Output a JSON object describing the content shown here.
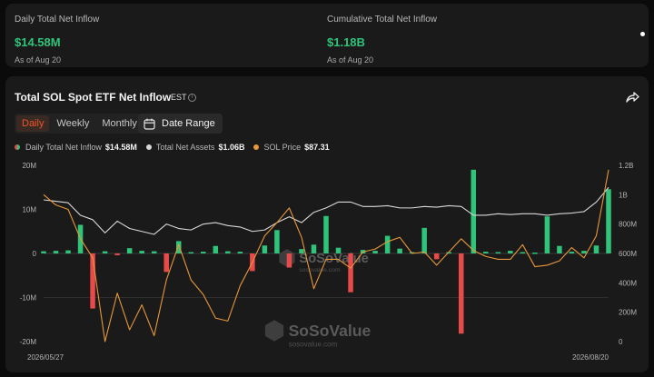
{
  "stats": [
    {
      "label": "Daily Total Net Inflow",
      "value": "$14.58M",
      "as_of": "As of Aug 20"
    },
    {
      "label": "Cumulative Total Net Inflow",
      "value": "$1.18B",
      "as_of": "As of Aug 20"
    }
  ],
  "chart_card": {
    "title": "Total SOL Spot ETF Net Inflow",
    "timezone": "EST",
    "info_glyph": "i",
    "tabs": [
      "Daily",
      "Weekly",
      "Monthly"
    ],
    "active_tab": "Daily",
    "date_range_label": "Date Range",
    "legend": [
      {
        "name": "Daily Total Net Inflow",
        "value": "$14.58M",
        "color_pos": "#2fc47a",
        "color_neg": "#e84a4a"
      },
      {
        "name": "Total Net Assets",
        "value": "$1.06B",
        "color": "#d8d8d8"
      },
      {
        "name": "SOL Price",
        "value": "$87.31",
        "color": "#e8973a"
      }
    ],
    "watermark": {
      "brand": "SoSoValue",
      "site": "sosovalue.com"
    },
    "icons": [
      "info-icon",
      "share-icon",
      "calendar-icon"
    ]
  },
  "chart_data": {
    "type": "bar",
    "x_start_label": "2026/05/27",
    "x_end_label": "2026/08/20",
    "left_axis": {
      "ticks": [
        "20M",
        "10M",
        "0",
        "-10M",
        "-20M"
      ],
      "values": [
        20,
        10,
        0,
        -10,
        -20
      ],
      "range": [
        -20,
        20
      ]
    },
    "right_axis": {
      "ticks": [
        "1.2B",
        "1B",
        "800M",
        "600M",
        "400M",
        "200M",
        "0"
      ],
      "values": [
        1.2,
        1.0,
        0.8,
        0.6,
        0.4,
        0.2,
        0
      ],
      "range": [
        0,
        1.2
      ]
    },
    "series": [
      {
        "name": "Daily Total Net Inflow",
        "type": "bar",
        "color_positive": "#2fc47a",
        "color_negative": "#e84a4a",
        "values": [
          0.5,
          0.6,
          0.7,
          6.5,
          -12.5,
          0.5,
          -0.4,
          1.2,
          0.6,
          0.5,
          -4.2,
          2.8,
          0.3,
          0.4,
          1.7,
          0.5,
          0.4,
          -4.0,
          1.8,
          5.3,
          -3.2,
          1.0,
          2.0,
          8.5,
          1.3,
          -8.8,
          0.8,
          0.6,
          4.0,
          1.1,
          0.3,
          5.8,
          -1.3,
          0.3,
          -18.2,
          19.0,
          0.4,
          0.3,
          0.6,
          0.3,
          0.2,
          8.4,
          1.7,
          0.4,
          0.6,
          1.8,
          14.58
        ]
      },
      {
        "name": "Total Net Assets",
        "type": "line",
        "axis": "right",
        "color": "#d8d8d8",
        "values": [
          0.965,
          0.955,
          0.945,
          0.86,
          0.83,
          0.74,
          0.82,
          0.77,
          0.75,
          0.73,
          0.8,
          0.77,
          0.76,
          0.8,
          0.81,
          0.79,
          0.78,
          0.75,
          0.76,
          0.81,
          0.85,
          0.81,
          0.88,
          0.91,
          0.95,
          0.95,
          0.92,
          0.92,
          0.925,
          0.91,
          0.91,
          0.92,
          0.915,
          0.925,
          0.92,
          0.86,
          0.86,
          0.87,
          0.865,
          0.87,
          0.87,
          0.86,
          0.87,
          0.875,
          0.885,
          0.95,
          1.05
        ]
      },
      {
        "name": "SOL Price",
        "type": "line",
        "axis": "right",
        "color": "#e8973a",
        "values": [
          1.0,
          0.93,
          0.9,
          0.7,
          0.57,
          0.0,
          0.33,
          0.08,
          0.25,
          0.04,
          0.42,
          0.66,
          0.42,
          0.32,
          0.16,
          0.14,
          0.38,
          0.54,
          0.72,
          0.81,
          0.91,
          0.71,
          0.36,
          0.56,
          0.56,
          0.5,
          0.61,
          0.63,
          0.68,
          0.71,
          0.6,
          0.61,
          0.52,
          0.61,
          0.7,
          0.62,
          0.58,
          0.56,
          0.56,
          0.66,
          0.51,
          0.52,
          0.55,
          0.64,
          0.57,
          0.72,
          1.17
        ]
      }
    ]
  }
}
